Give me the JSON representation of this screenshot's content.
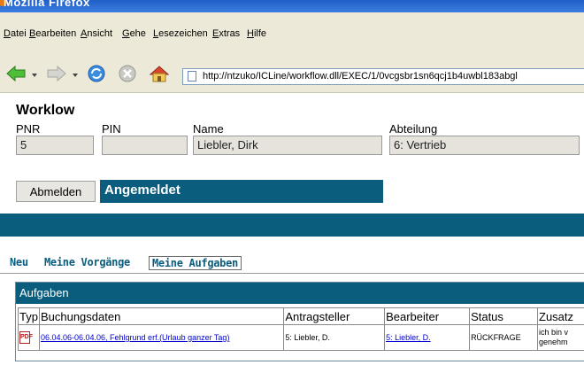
{
  "window": {
    "title": "Mozilla Firefox"
  },
  "menu": {
    "items": [
      "Datei",
      "Bearbeiten",
      "Ansicht",
      "Gehe",
      "Lesezeichen",
      "Extras",
      "Hilfe"
    ]
  },
  "toolbar": {
    "url": "http://ntzuko/ICLine/workflow.dll/EXEC/1/0vcgsbr1sn6qcj1b4uwbl183abgl"
  },
  "page": {
    "title": "Worklow",
    "fields": {
      "pnr_label": "PNR",
      "pnr_value": "5",
      "pin_label": "PIN",
      "pin_value": "",
      "name_label": "Name",
      "name_value": "Liebler, Dirk",
      "abteilung_label": "Abteilung",
      "abteilung_value": "6: Vertrieb"
    },
    "logout_label": "Abmelden",
    "status_text": "Angemeldet",
    "tabs": [
      "Neu",
      "Meine Vorgänge",
      "Meine Aufgaben"
    ],
    "active_tab": "Meine Aufgaben"
  },
  "tasks": {
    "header": "Aufgaben",
    "columns": [
      "Typ",
      "Buchungsdaten",
      "Antragsteller",
      "Bearbeiter",
      "Status",
      "Zusatz"
    ],
    "rows": [
      {
        "icon": "pdf-document-icon",
        "buchungsdaten": "06.04.06-06.04.06, Fehlgrund erf.(Urlaub ganzer Tag)",
        "antragsteller": "5: Liebler, D.",
        "bearbeiter": "5: Liebler, D.",
        "status": "RÜCKFRAGE",
        "zusatz_line1": "ich bin v",
        "zusatz_line2": "genehm"
      }
    ]
  },
  "colors": {
    "accent": "#0b5d7e",
    "link": "#0000cc",
    "chrome": "#ece9d8"
  }
}
